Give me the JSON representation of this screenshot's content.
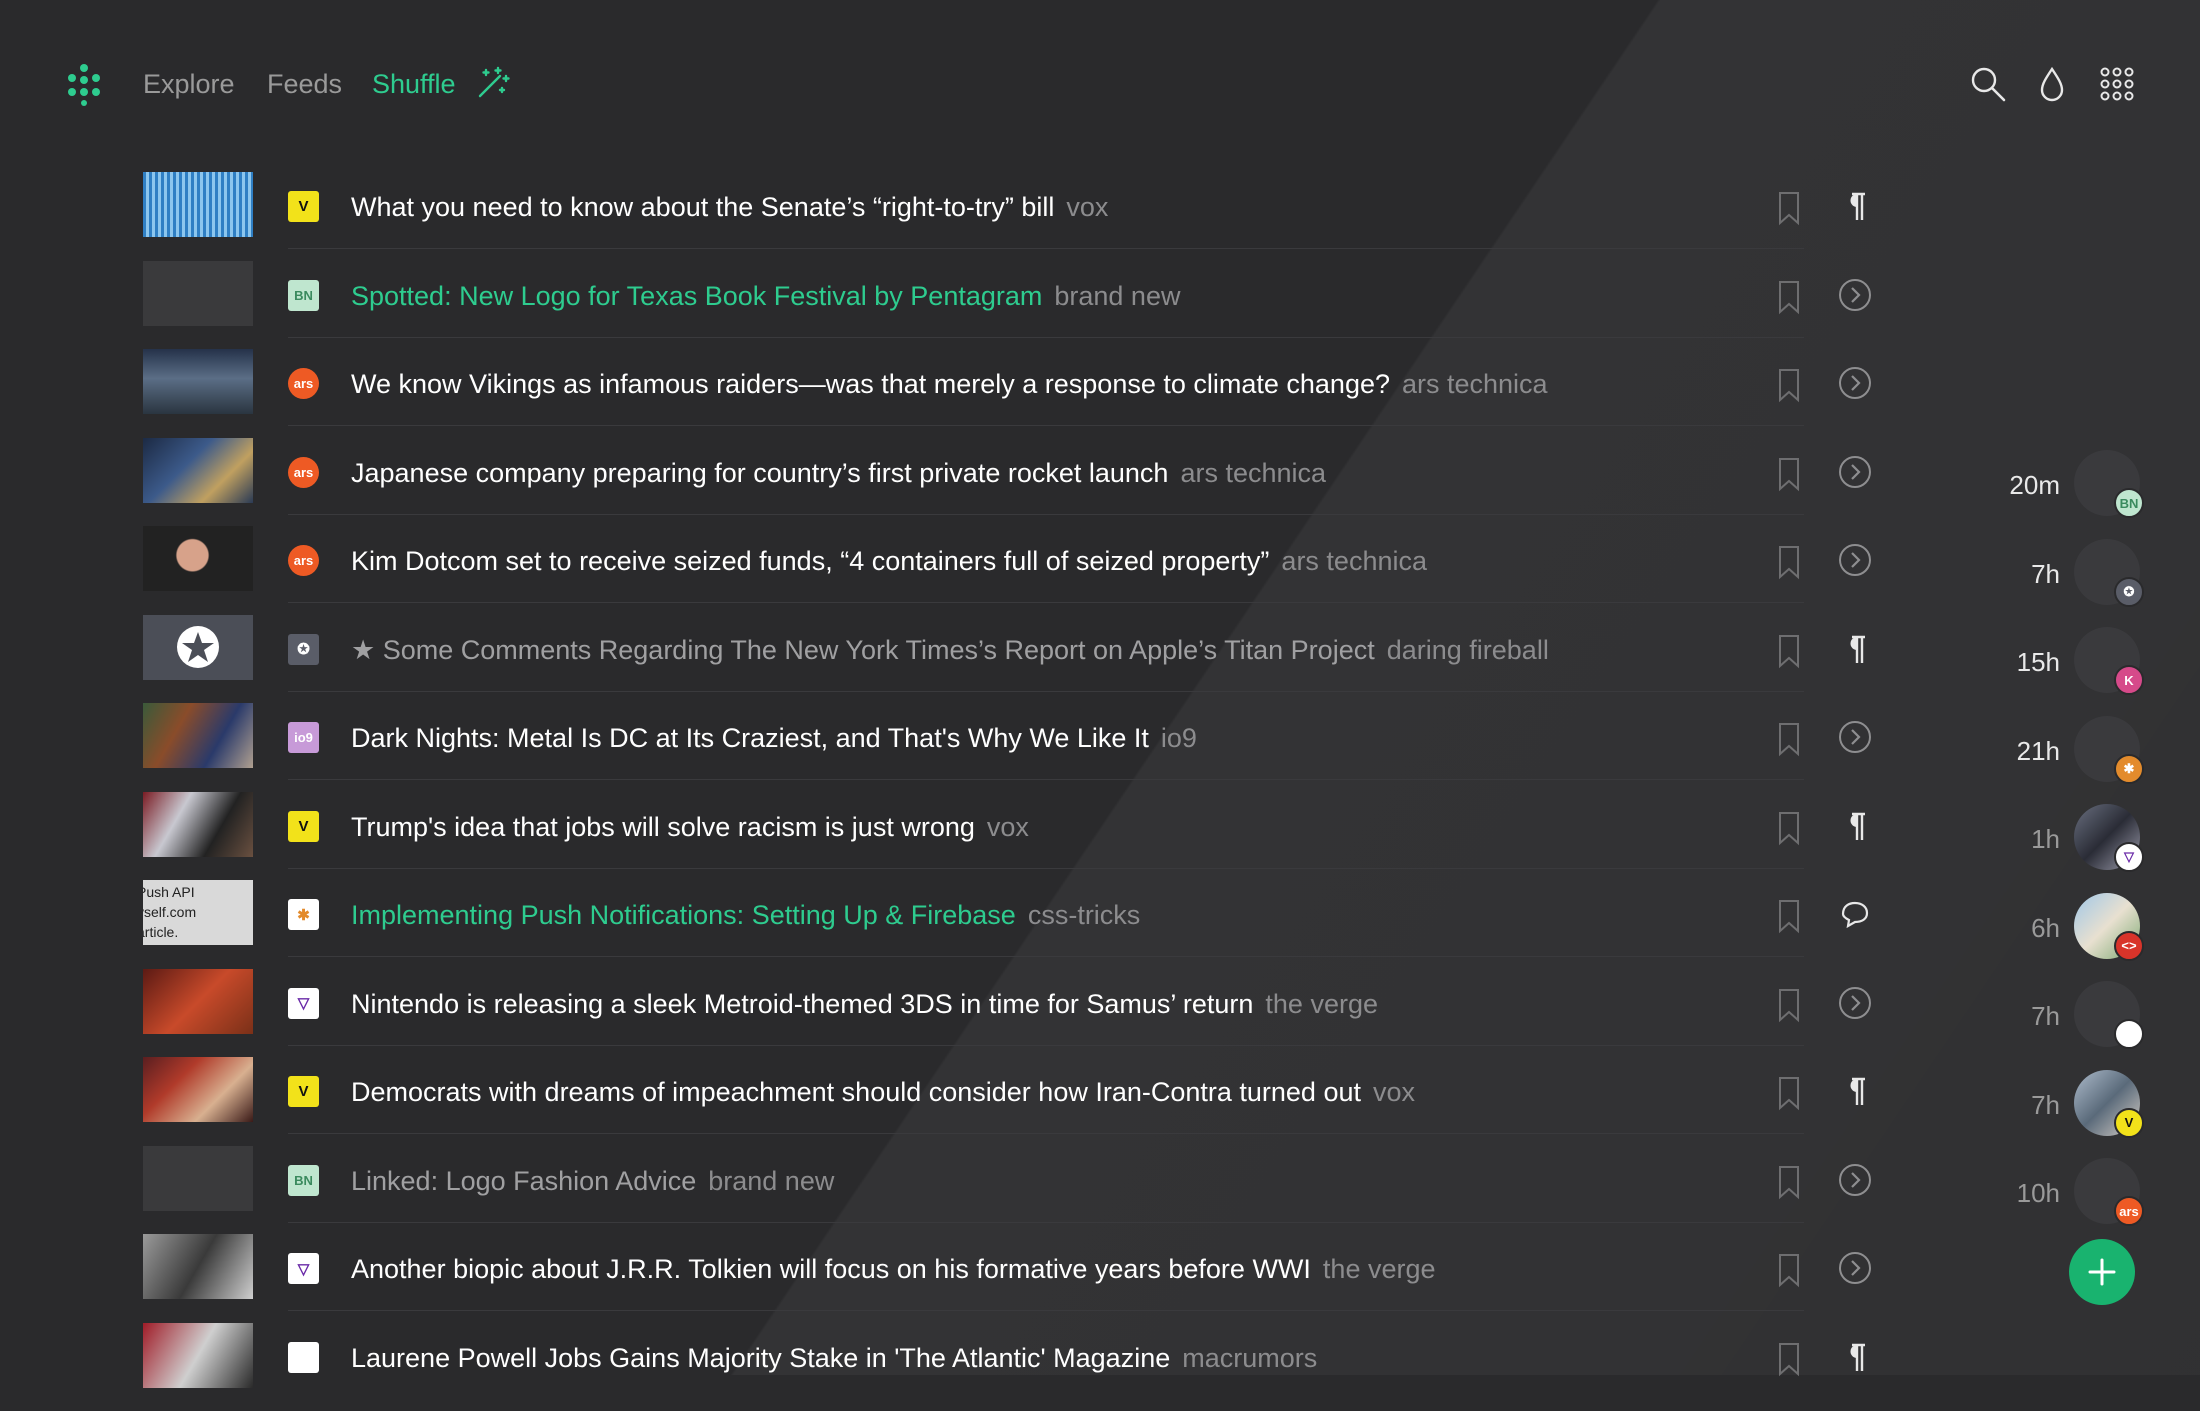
{
  "header": {
    "nav": [
      "Explore",
      "Feeds",
      "Shuffle"
    ],
    "active_nav": "Shuffle",
    "icons": [
      "logo-dots-icon",
      "magic-wand-icon",
      "search-icon",
      "drop-icon",
      "apps-grid-icon"
    ]
  },
  "colors": {
    "accent": "#2ecc8f",
    "background": "#2a2a2c",
    "fab": "#19b36f"
  },
  "articles": [
    {
      "title": "What you need to know about the Senate’s “right-to-try” bill",
      "source": "vox",
      "source_icon": "V",
      "action": "paragraph-icon",
      "style": "normal"
    },
    {
      "title": "Spotted: New Logo for Texas Book Festival by Pentagram",
      "source": "brand new",
      "source_icon": "BN",
      "action": "arrow-circle-icon",
      "style": "green"
    },
    {
      "title": "We know Vikings as infamous raiders—was that merely a response to climate change?",
      "source": "ars technica",
      "source_icon": "ars",
      "action": "arrow-circle-icon",
      "style": "normal"
    },
    {
      "title": "Japanese company preparing for country’s first private rocket launch",
      "source": "ars technica",
      "source_icon": "ars",
      "action": "arrow-circle-icon",
      "style": "normal"
    },
    {
      "title": "Kim Dotcom set to receive seized funds, “4 containers full of seized property”",
      "source": "ars technica",
      "source_icon": "ars",
      "action": "arrow-circle-icon",
      "style": "normal"
    },
    {
      "title": "★ Some Comments Regarding The New York Times’s Report on Apple’s Titan Project",
      "source": "daring fireball",
      "source_icon": "✪",
      "action": "paragraph-icon",
      "style": "dim"
    },
    {
      "title": "Dark Nights: Metal Is DC at Its Craziest, and That's Why We Like It",
      "source": "io9",
      "source_icon": "io9",
      "action": "arrow-circle-icon",
      "style": "normal"
    },
    {
      "title": "Trump's idea that jobs will solve racism is just wrong",
      "source": "vox",
      "source_icon": "V",
      "action": "paragraph-icon",
      "style": "normal"
    },
    {
      "title": "Implementing Push Notifications: Setting Up & Firebase",
      "source": "css-tricks",
      "source_icon": "✱",
      "action": "comments-icon",
      "style": "green"
    },
    {
      "title": "Nintendo is releasing a sleek Metroid-themed 3DS in time for Samus’ return",
      "source": "the verge",
      "source_icon": "▽",
      "action": "arrow-circle-icon",
      "style": "normal"
    },
    {
      "title": "Democrats with dreams of impeachment should consider how Iran-Contra turned out",
      "source": "vox",
      "source_icon": "V",
      "action": "paragraph-icon",
      "style": "normal"
    },
    {
      "title": "Linked: Logo Fashion Advice",
      "source": "brand new",
      "source_icon": "BN",
      "action": "arrow-circle-icon",
      "style": "dim"
    },
    {
      "title": "Another biopic about J.R.R. Tolkien will focus on his formative years before WWI",
      "source": "the verge",
      "source_icon": "▽",
      "action": "arrow-circle-icon",
      "style": "normal"
    },
    {
      "title": "Laurene Powell Jobs Gains Majority Stake in 'The Atlantic' Magazine",
      "source": "macrumors",
      "source_icon": "",
      "action": "paragraph-icon",
      "style": "normal"
    }
  ],
  "thumb_text": [
    "Push API",
    "yself.com",
    "article."
  ],
  "recent": [
    {
      "time": "20m",
      "badge": "BN",
      "style": "bright"
    },
    {
      "time": "7h",
      "badge": "✪",
      "style": "bright"
    },
    {
      "time": "15h",
      "badge": "K",
      "style": "bright"
    },
    {
      "time": "21h",
      "badge": "✱",
      "style": "bright"
    },
    {
      "time": "1h",
      "badge": "▽",
      "style": "dim"
    },
    {
      "time": "6h",
      "badge": "<>",
      "style": "dim"
    },
    {
      "time": "7h",
      "badge": "",
      "style": "dim"
    },
    {
      "time": "7h",
      "badge": "V",
      "style": "dim"
    },
    {
      "time": "10h",
      "badge": "ars",
      "style": "dim"
    }
  ],
  "fab_icon": "plus-icon"
}
